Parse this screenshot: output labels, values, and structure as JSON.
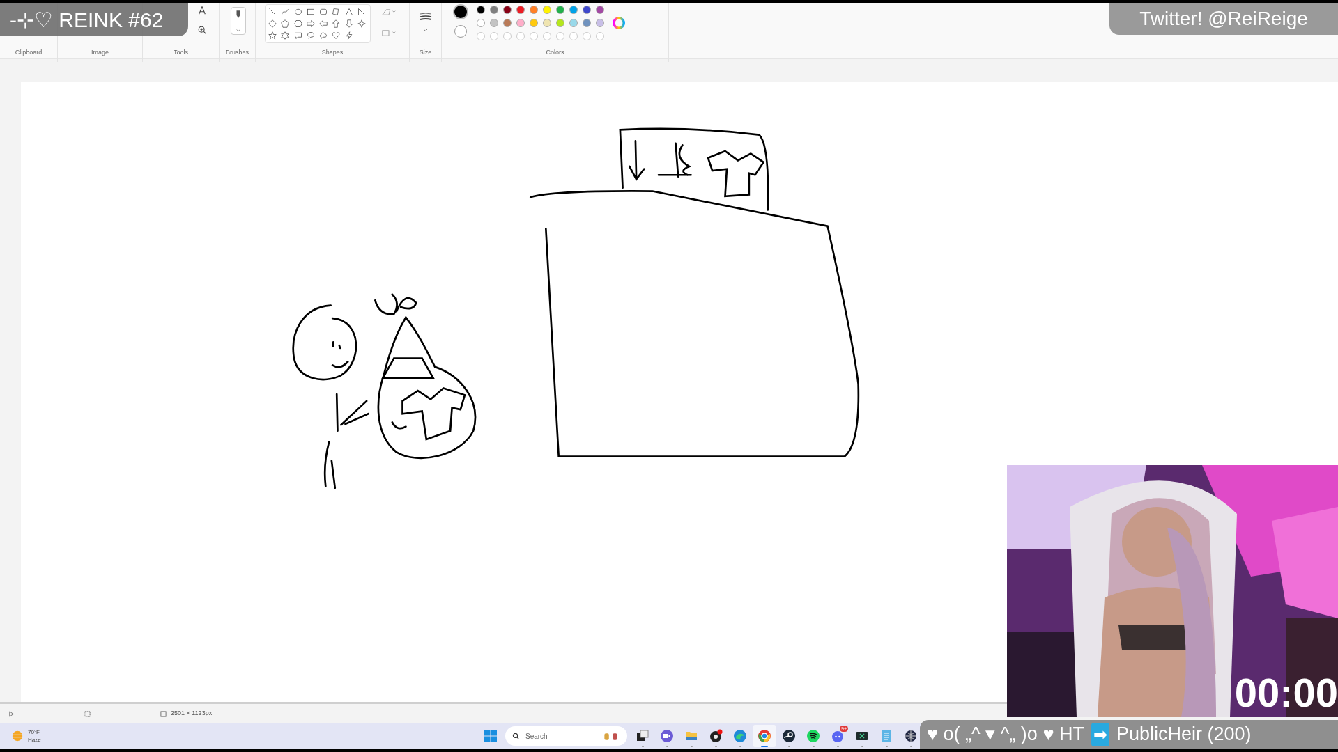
{
  "overlays": {
    "stream_title": "-⊹♡ REINK #62",
    "social": "Twitter! @ReiReige",
    "timer": "00:00",
    "chat_alert": {
      "message": "♥ o( „^ ▾ ^„ )o ♥ HT",
      "arrow": "➡",
      "user": "PublicHeir (200)"
    }
  },
  "ribbon": {
    "groups": [
      "Clipboard",
      "Image",
      "Tools",
      "Brushes",
      "Shapes",
      "Size",
      "Colors"
    ],
    "current_colors": [
      {
        "color": "#000000"
      },
      {
        "color": "#ffffff"
      }
    ],
    "palette": [
      {
        "color": "#000000"
      },
      {
        "color": "#7f7f7f"
      },
      {
        "color": "#880015"
      },
      {
        "color": "#ed1c24"
      },
      {
        "color": "#ff7f27"
      },
      {
        "color": "#fff200"
      },
      {
        "color": "#22b14c"
      },
      {
        "color": "#00a2e8"
      },
      {
        "color": "#3f48cc"
      },
      {
        "color": "#a349a4"
      },
      {
        "color": "#ffffff"
      },
      {
        "color": "#c3c3c3"
      },
      {
        "color": "#b97a57"
      },
      {
        "color": "#ffaec9"
      },
      {
        "color": "#ffc90e"
      },
      {
        "color": "#efe4b0"
      },
      {
        "color": "#b5e61d"
      },
      {
        "color": "#99d9ea"
      },
      {
        "color": "#7092be"
      },
      {
        "color": "#c8bfe7"
      }
    ]
  },
  "status_bar": {
    "canvas_size": "2501 × 1123px"
  },
  "taskbar": {
    "weather": {
      "temperature": "70°F",
      "condition": "Haze"
    },
    "search": {
      "placeholder": "Search"
    },
    "apps": [
      {
        "kind": "task-view",
        "active": false
      },
      {
        "kind": "meet",
        "active": false
      },
      {
        "kind": "folder",
        "active": false
      },
      {
        "kind": "recorder",
        "active": false
      },
      {
        "kind": "edge",
        "active": false
      },
      {
        "kind": "chrome",
        "active": true
      },
      {
        "kind": "steam",
        "active": false
      },
      {
        "kind": "spotify",
        "active": false
      },
      {
        "kind": "chat",
        "active": false,
        "badge": "9+"
      },
      {
        "kind": "terminal",
        "active": false
      },
      {
        "kind": "notepad",
        "active": false
      },
      {
        "kind": "globe",
        "active": false
      }
    ]
  }
}
